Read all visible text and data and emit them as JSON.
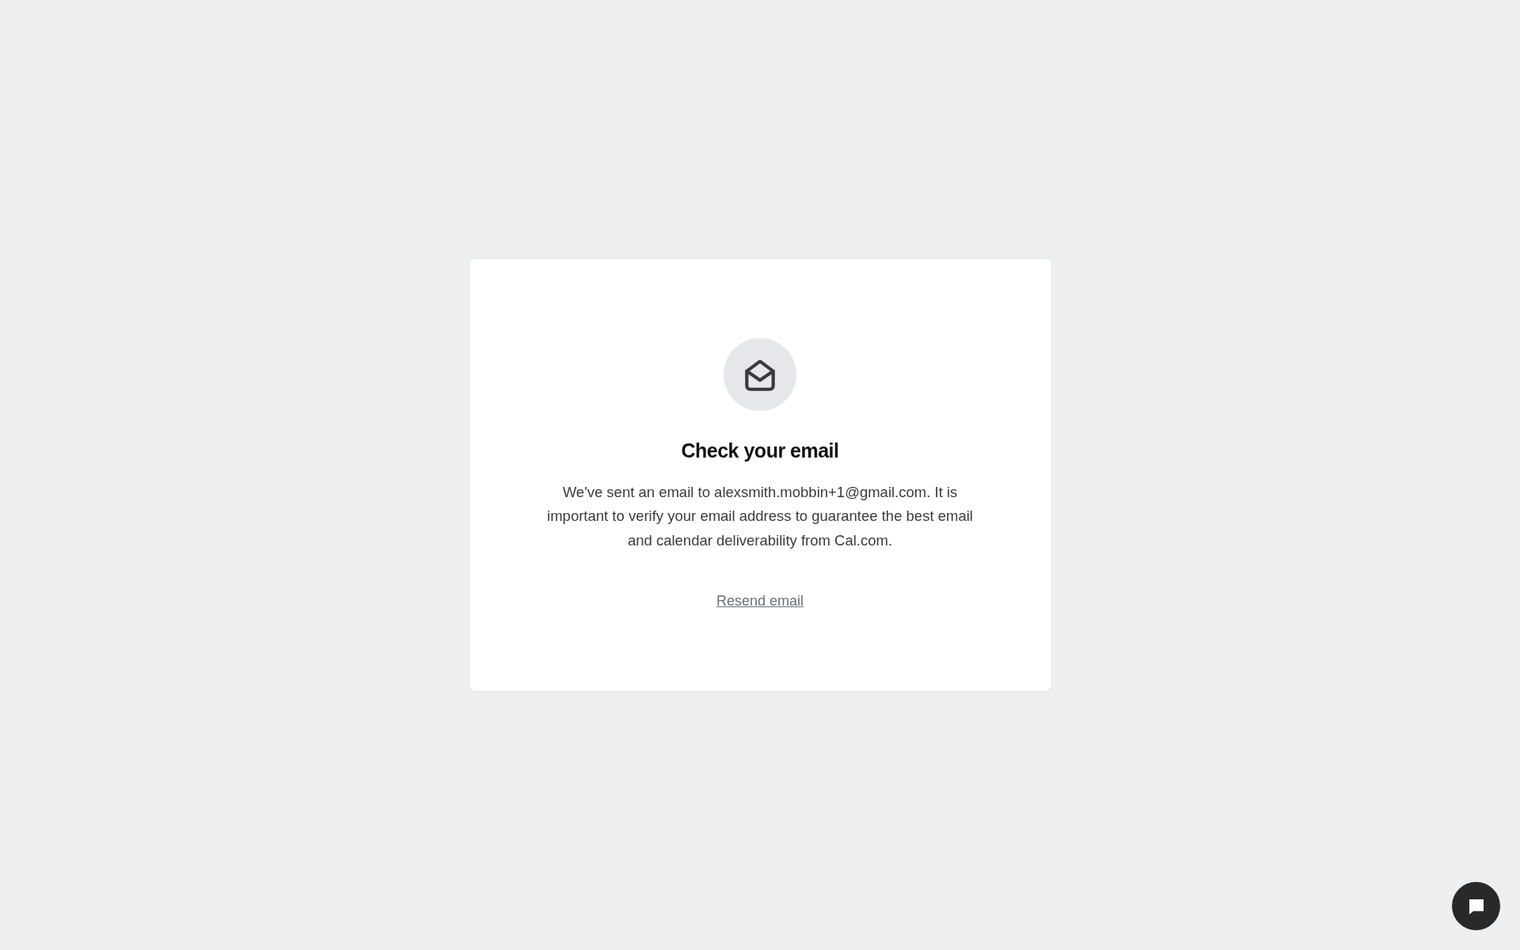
{
  "card": {
    "title": "Check your email",
    "message": "We've sent an email to alexsmith.mobbin+1@gmail.com. It is important to verify your email address to guarantee the best email and calendar deliverability from Cal.com.",
    "link": "Resend email"
  }
}
